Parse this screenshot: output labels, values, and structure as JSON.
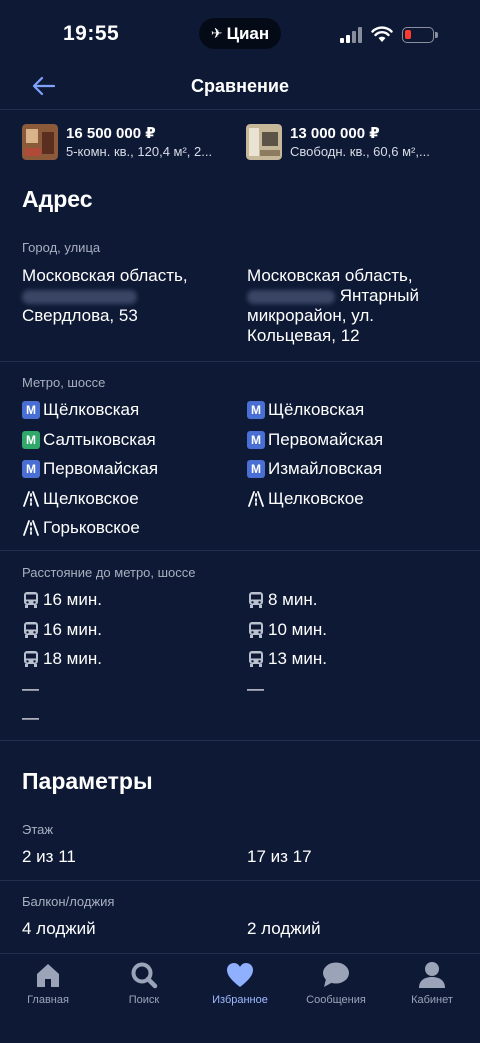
{
  "status_bar": {
    "time": "19:55",
    "island_app": "Циан",
    "battery_color": "#ff3b30"
  },
  "header": {
    "title": "Сравнение",
    "back_icon": "arrow-left-icon"
  },
  "listings": [
    {
      "price": "16 500 000 ₽",
      "summary": "5-комн. кв., 120,4 м², 2..."
    },
    {
      "price": "13 000 000 ₽",
      "summary": "Свободн. кв., 60,6 м²,..."
    }
  ],
  "address_section": {
    "title": "Адрес",
    "city_label": "Город, улица",
    "col1": {
      "line1": "Московская область,",
      "line3": "Свердлова, 53"
    },
    "col2": {
      "line1": "Московская область,",
      "line2_tail": "Янтарный",
      "line3": "микрорайон, ул.",
      "line4": "Кольцевая, 12"
    }
  },
  "metro_section": {
    "label": "Метро, шоссе",
    "col1": [
      {
        "name": "Щёлковская",
        "type": "metro",
        "color": "#4a6fd4"
      },
      {
        "name": "Салтыковская",
        "type": "metro",
        "color": "#2fa869"
      },
      {
        "name": "Первомайская",
        "type": "metro",
        "color": "#4a6fd4"
      },
      {
        "name": "Щелковское",
        "type": "highway"
      },
      {
        "name": "Горьковское",
        "type": "highway"
      }
    ],
    "col2": [
      {
        "name": "Щёлковская",
        "type": "metro",
        "color": "#4a6fd4"
      },
      {
        "name": "Первомайская",
        "type": "metro",
        "color": "#4a6fd4"
      },
      {
        "name": "Измайловская",
        "type": "metro",
        "color": "#4a6fd4"
      },
      {
        "name": "Щелковское",
        "type": "highway"
      }
    ]
  },
  "distance_section": {
    "label": "Расстояние до метро, шоссе",
    "col1": [
      "16 мин.",
      "16 мин.",
      "18 мин.",
      "—",
      "—"
    ],
    "col2": [
      "8 мин.",
      "10 мин.",
      "13 мин.",
      "—"
    ]
  },
  "params_section": {
    "title": "Параметры",
    "floor_label": "Этаж",
    "floor": [
      "2 из 11",
      "17 из 17"
    ],
    "balcony_label": "Балкон/лоджия",
    "balcony": [
      "4 лоджий",
      "2 лоджий"
    ]
  },
  "tabbar": {
    "accent": "#8fb0ff",
    "items": [
      {
        "label": "Главная",
        "icon": "home-icon"
      },
      {
        "label": "Поиск",
        "icon": "search-icon"
      },
      {
        "label": "Избранное",
        "icon": "heart-icon"
      },
      {
        "label": "Сообщения",
        "icon": "chat-icon"
      },
      {
        "label": "Кабинет",
        "icon": "profile-icon"
      }
    ]
  }
}
